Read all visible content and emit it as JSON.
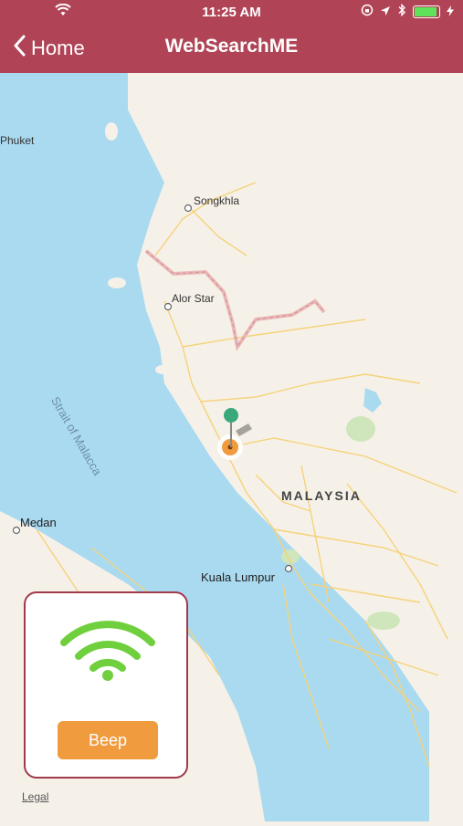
{
  "status_bar": {
    "time": "11:25 AM",
    "wifi_icon": "wifi-icon",
    "location_icon": "location-icon",
    "bluetooth_icon": "bluetooth-icon",
    "battery_level": 0.9,
    "battery_color": "#5ee35b"
  },
  "nav": {
    "back_label": "Home",
    "title": "WebSearchME",
    "bar_color": "#b04456"
  },
  "map": {
    "labels": {
      "phuket": "Phuket",
      "songkhla": "Songkhla",
      "alor_star": "Alor Star",
      "medan": "Medan",
      "kuala_lumpur": "Kuala Lumpur",
      "malaysia": "MALAYSIA",
      "strait": "Strait of Malacca"
    },
    "legal": "Legal",
    "water_color": "#aadaf0",
    "land_color": "#f6f1e8"
  },
  "card": {
    "beep_label": "Beep",
    "signal_icon": "wifi-signal-icon",
    "accent_color": "#6fcf3c",
    "button_color": "#ef9b3e"
  }
}
